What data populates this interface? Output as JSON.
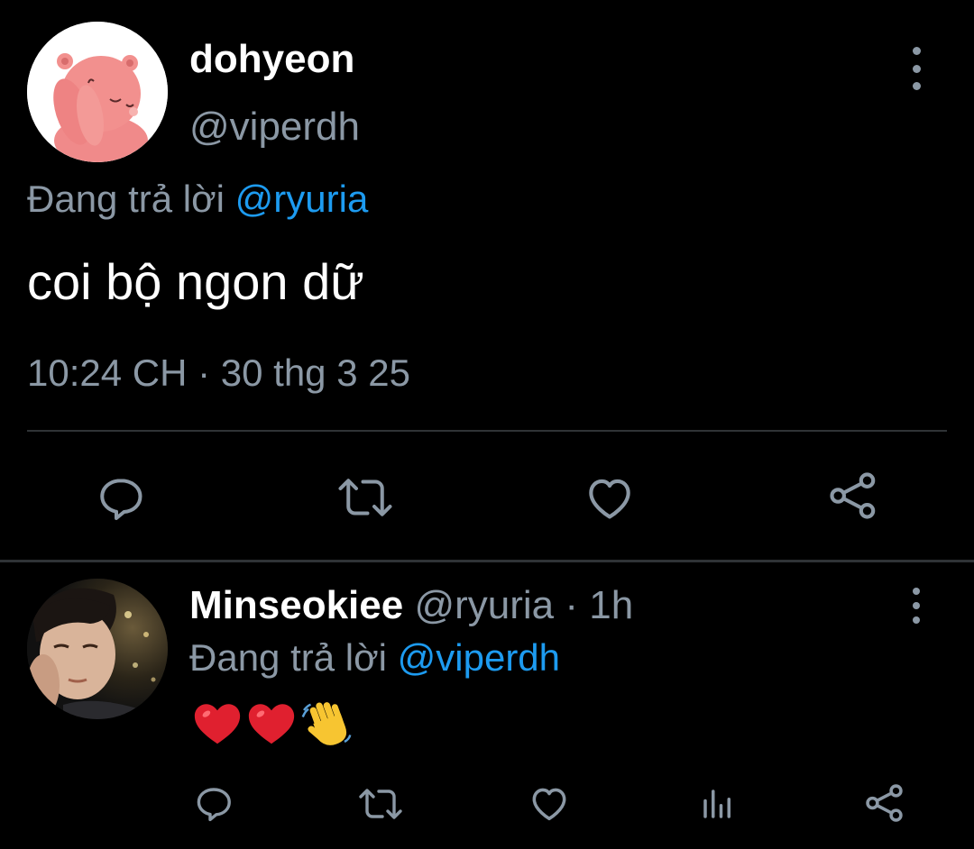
{
  "main_tweet": {
    "display_name": "dohyeon",
    "handle": "@viperdh",
    "replying_prefix": "Đang trả lời",
    "replying_to": "@ryuria",
    "text": "coi bộ ngon dữ",
    "timestamp": "10:24 CH · 30 thg 3 25",
    "actions": [
      "reply-icon",
      "retweet-icon",
      "heart-icon",
      "share-icon"
    ]
  },
  "reply_tweet": {
    "display_name": "Minseokiee",
    "handle": "@ryuria",
    "separator": " · ",
    "time": "1h",
    "replying_prefix": "Đang trả lời",
    "replying_to": "@viperdh",
    "text": "❤️❤️👋",
    "actions": [
      "reply-icon",
      "retweet-icon",
      "heart-icon",
      "analytics-icon",
      "share-icon"
    ]
  },
  "colors": {
    "background": "#000000",
    "text_primary": "#ffffff",
    "text_secondary": "#8b98a5",
    "accent": "#1d9bf0",
    "divider": "#2f3336"
  }
}
